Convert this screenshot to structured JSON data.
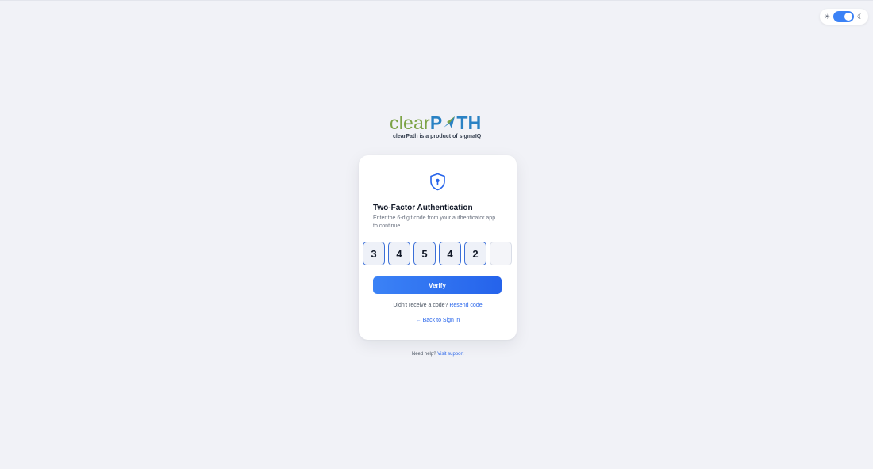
{
  "theme_toggle": {
    "sun_icon": "☀",
    "moon_icon": "☾",
    "state": "dark-enabled"
  },
  "logo": {
    "clear": "clear",
    "path_p": "P",
    "path_rest": "TH",
    "tagline": "clearPath is a product of sigmaIQ"
  },
  "card": {
    "title": "Two-Factor Authentication",
    "description": "Enter the 6-digit code from your authenticator app to continue.",
    "code_digits": [
      "3",
      "4",
      "5",
      "4",
      "2",
      ""
    ],
    "verify_label": "Verify",
    "resend_prompt": "Didn't receive a code?",
    "resend_label": "Resend code",
    "back_label": "← Back to Sign in"
  },
  "footer": {
    "help_prompt": "Need help?",
    "support_label": "Visit support"
  },
  "colors": {
    "accent": "#3b82f6",
    "logo_green": "#7ca346",
    "logo_blue": "#2a82c4",
    "background": "#f1f2f7"
  }
}
